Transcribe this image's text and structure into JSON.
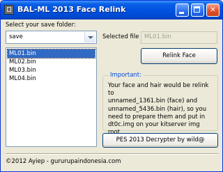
{
  "window": {
    "title": "BAL-ML 2013 Face Relink"
  },
  "save_folder": {
    "label": "Select your save folder:",
    "selected": "save"
  },
  "files": [
    "ML01.bin",
    "ML02.bin",
    "ML03.bin",
    "ML04.bin"
  ],
  "selected_file": {
    "label": "Selected file",
    "value": "ML01.bin"
  },
  "buttons": {
    "relink": "Relink Face",
    "decrypter": "PES 2013 Decrypter by wild@"
  },
  "important": {
    "title": "Important:",
    "lines": [
      "Your face and hair would be relink to",
      "unnamed_1361.bin (face) and",
      "unnamed_5436.bin (hair), so you",
      "need to prepare them and put in",
      "dt0c.img on your kitserver img root."
    ]
  },
  "footer": "©2012 Ayiep - gururupaindonesia.com"
}
